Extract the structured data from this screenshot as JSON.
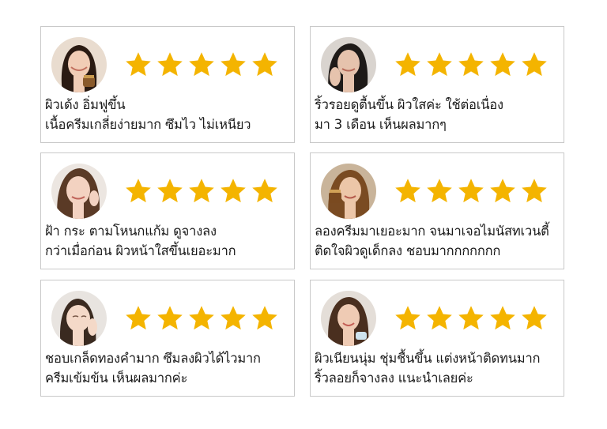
{
  "colors": {
    "star": "#f4b400",
    "border": "#c9c9c9",
    "text": "#1a1a1a"
  },
  "reviews": [
    {
      "line1": "ผิวเด้ง อิ่มฟูขึ้น",
      "line2": "เนื้อครีมเกลี่ยง่ายมาก ซึมไว ไม่เหนียว",
      "rating": 5,
      "avatar_icon": "user-photo"
    },
    {
      "line1": "ริ้วรอยดูตื้นขึ้น ผิวใสค่ะ ใช้ต่อเนื่อง",
      "line2": "มา 3 เดือน เห็นผลมากๆ",
      "rating": 5,
      "avatar_icon": "user-photo"
    },
    {
      "line1": "ฝ้า กระ ตามโหนกแก้ม ดูจางลง",
      "line2": "กว่าเมื่อก่อน ผิวหน้าใสขึ้นเยอะมาก",
      "rating": 5,
      "avatar_icon": "user-photo"
    },
    {
      "line1": "ลองครีมมาเยอะมาก จนมาเจอไมนัสทเวนตี้",
      "line2": "ติดใจผิวดูเด็กลง ชอบมากกกกกกก",
      "rating": 5,
      "avatar_icon": "user-photo"
    },
    {
      "line1": "ชอบเกล็ดทองคำมาก ซึมลงผิวได้ไวมาก",
      "line2": "ครีมเข้มข้น เห็นผลมากค่ะ",
      "rating": 5,
      "avatar_icon": "user-photo"
    },
    {
      "line1": "ผิวเนียนนุ่ม ชุ่มชื้นขึ้น แต่งหน้าติดทนมาก",
      "line2": "ริ้วลอยก็จางลง แนะนำเลยค่ะ",
      "rating": 5,
      "avatar_icon": "user-photo"
    }
  ]
}
